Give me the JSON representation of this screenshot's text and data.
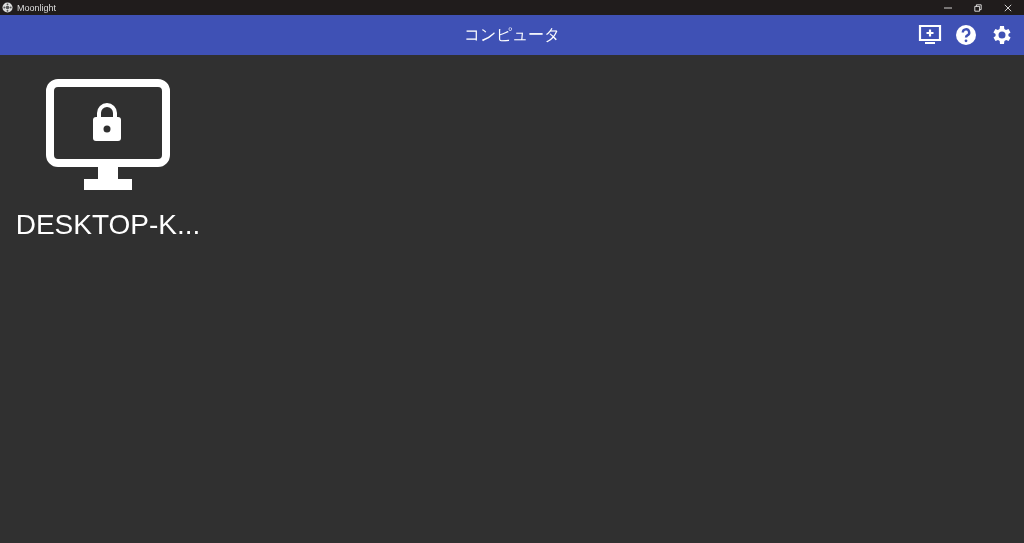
{
  "window": {
    "title": "Moonlight"
  },
  "toolbar": {
    "title": "コンピュータ"
  },
  "computers": [
    {
      "name": "DESKTOP-K...",
      "locked": true
    }
  ]
}
